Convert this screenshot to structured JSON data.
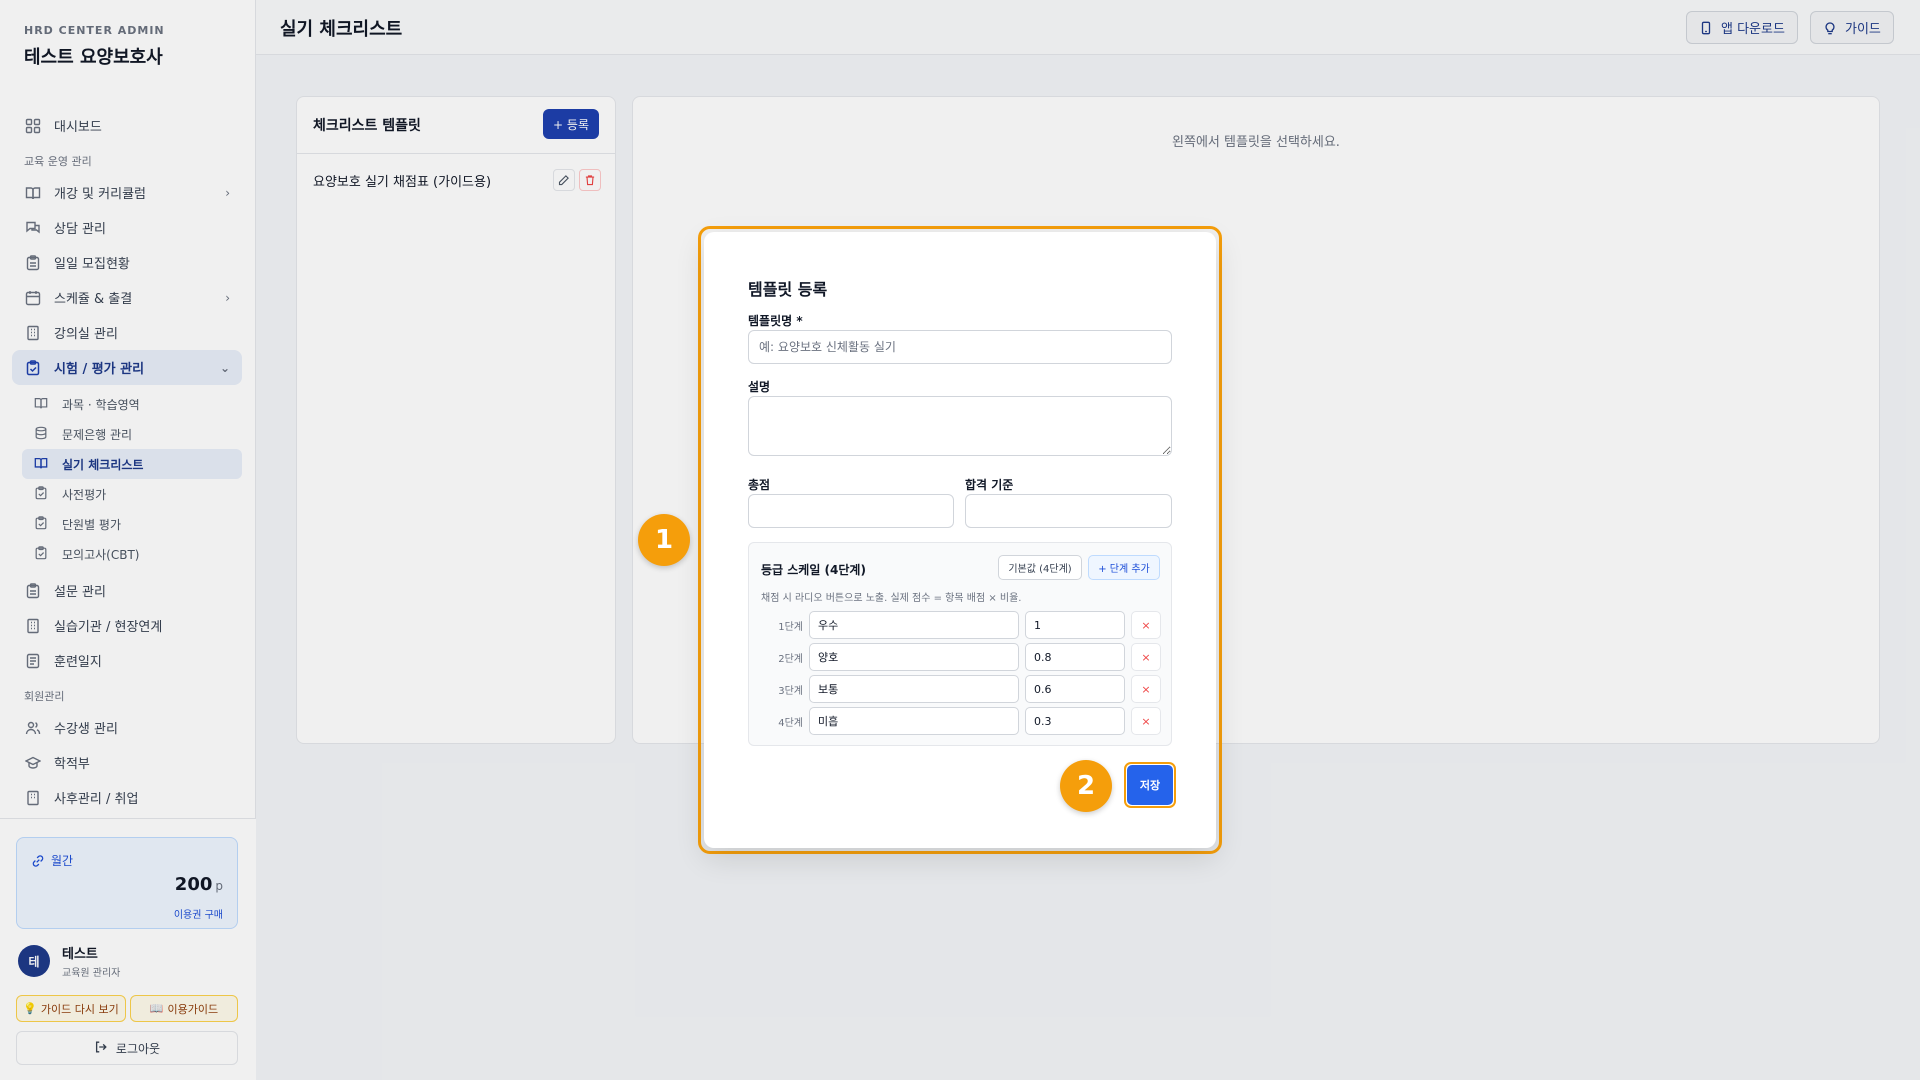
{
  "brand": {
    "subtitle": "HRD CENTER ADMIN",
    "title": "테스트 요양보호사"
  },
  "sidebar": {
    "dashboard": "대시보드",
    "section_edu": "교육 운영 관리",
    "items": [
      {
        "label": "개강 및 커리큘럼",
        "icon": "book-icon"
      },
      {
        "label": "상담 관리",
        "icon": "chat-icon"
      },
      {
        "label": "일일 모집현황",
        "icon": "clipboard-icon"
      },
      {
        "label": "스케쥴 & 출결",
        "icon": "calendar-icon"
      },
      {
        "label": "강의실 관리",
        "icon": "building-icon"
      },
      {
        "label": "시험 / 평가 관리",
        "icon": "clipboard-check-icon"
      }
    ],
    "sub_items": [
      {
        "label": "과목 · 학습영역"
      },
      {
        "label": "문제은행 관리"
      },
      {
        "label": "실기 체크리스트"
      },
      {
        "label": "사전평가"
      },
      {
        "label": "단원별 평가"
      },
      {
        "label": "모의고사(CBT)"
      }
    ],
    "more_items": [
      {
        "label": "설문 관리"
      },
      {
        "label": "실습기관 / 현장연계"
      },
      {
        "label": "훈련일지"
      }
    ],
    "section_member": "회원관리",
    "member_items": [
      {
        "label": "수강생 관리"
      },
      {
        "label": "학적부"
      },
      {
        "label": "사후관리 / 취업"
      }
    ]
  },
  "plan": {
    "label": "월간",
    "points": "200",
    "unit": "p",
    "link": "이용권 구매"
  },
  "user": {
    "avatar": "테",
    "name": "테스트",
    "role": "교육원 관리자"
  },
  "bottom_buttons": {
    "guide_again": "가이드 다시 보기",
    "usage_guide": "이용가이드",
    "logout": "로그아웃"
  },
  "header": {
    "title": "실기 체크리스트",
    "app_download": "앱 다운로드",
    "guide": "가이드"
  },
  "templates": {
    "title": "체크리스트 템플릿",
    "add_button": "+ 등록",
    "items": [
      "요양보호 실기 채점표 (가이드용)"
    ],
    "empty_hint": "왼쪽에서 템플릿을 선택하세요."
  },
  "modal": {
    "title": "템플릿 등록",
    "name_label": "템플릿명 *",
    "name_placeholder": "예: 요양보호 신체활동 실기",
    "desc_label": "설명",
    "total_label": "총점",
    "pass_label": "합격 기준",
    "scale_title": "등급 스케일 (4단계)",
    "default_btn": "기본값 (4단계)",
    "add_stage_btn": "+ 단계 추가",
    "scale_help": "채점 시 라디오 버튼으로 노출. 실제 점수 = 항목 배점 × 비율.",
    "stages": [
      {
        "stage": "1단계",
        "name": "우수",
        "ratio": "1"
      },
      {
        "stage": "2단계",
        "name": "양호",
        "ratio": "0.8"
      },
      {
        "stage": "3단계",
        "name": "보통",
        "ratio": "0.6"
      },
      {
        "stage": "4단계",
        "name": "미흡",
        "ratio": "0.3"
      }
    ],
    "delete_symbol": "×",
    "save": "저장"
  },
  "callouts": {
    "one": "1",
    "two": "2"
  },
  "colors": {
    "accent": "#f59e0b",
    "primary": "#1e40af",
    "save": "#2563eb"
  }
}
